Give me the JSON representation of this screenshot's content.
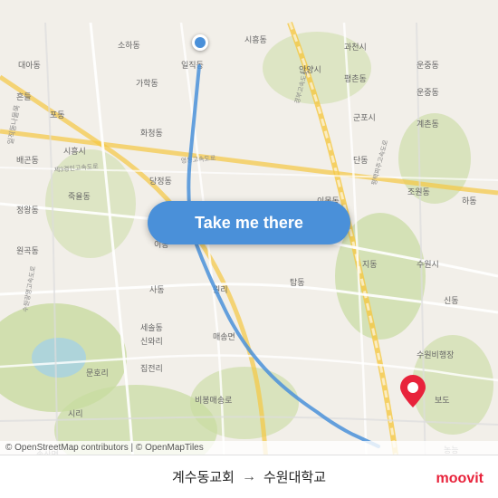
{
  "map": {
    "background_color": "#f2efe9",
    "attribution": "© OpenStreetMap contributors | © OpenMapTiles"
  },
  "button": {
    "label": "Take me there"
  },
  "route": {
    "origin": "계수동교회",
    "destination": "수원대학교",
    "arrow": "→"
  },
  "branding": {
    "logo": "moovit"
  },
  "colors": {
    "button_bg": "#4a90d9",
    "button_text": "#ffffff",
    "dest_marker": "#e8233b",
    "road_main": "#ffffff",
    "road_secondary": "#f5e9c8",
    "greenery": "#c8dba0",
    "water": "#aad3df"
  }
}
